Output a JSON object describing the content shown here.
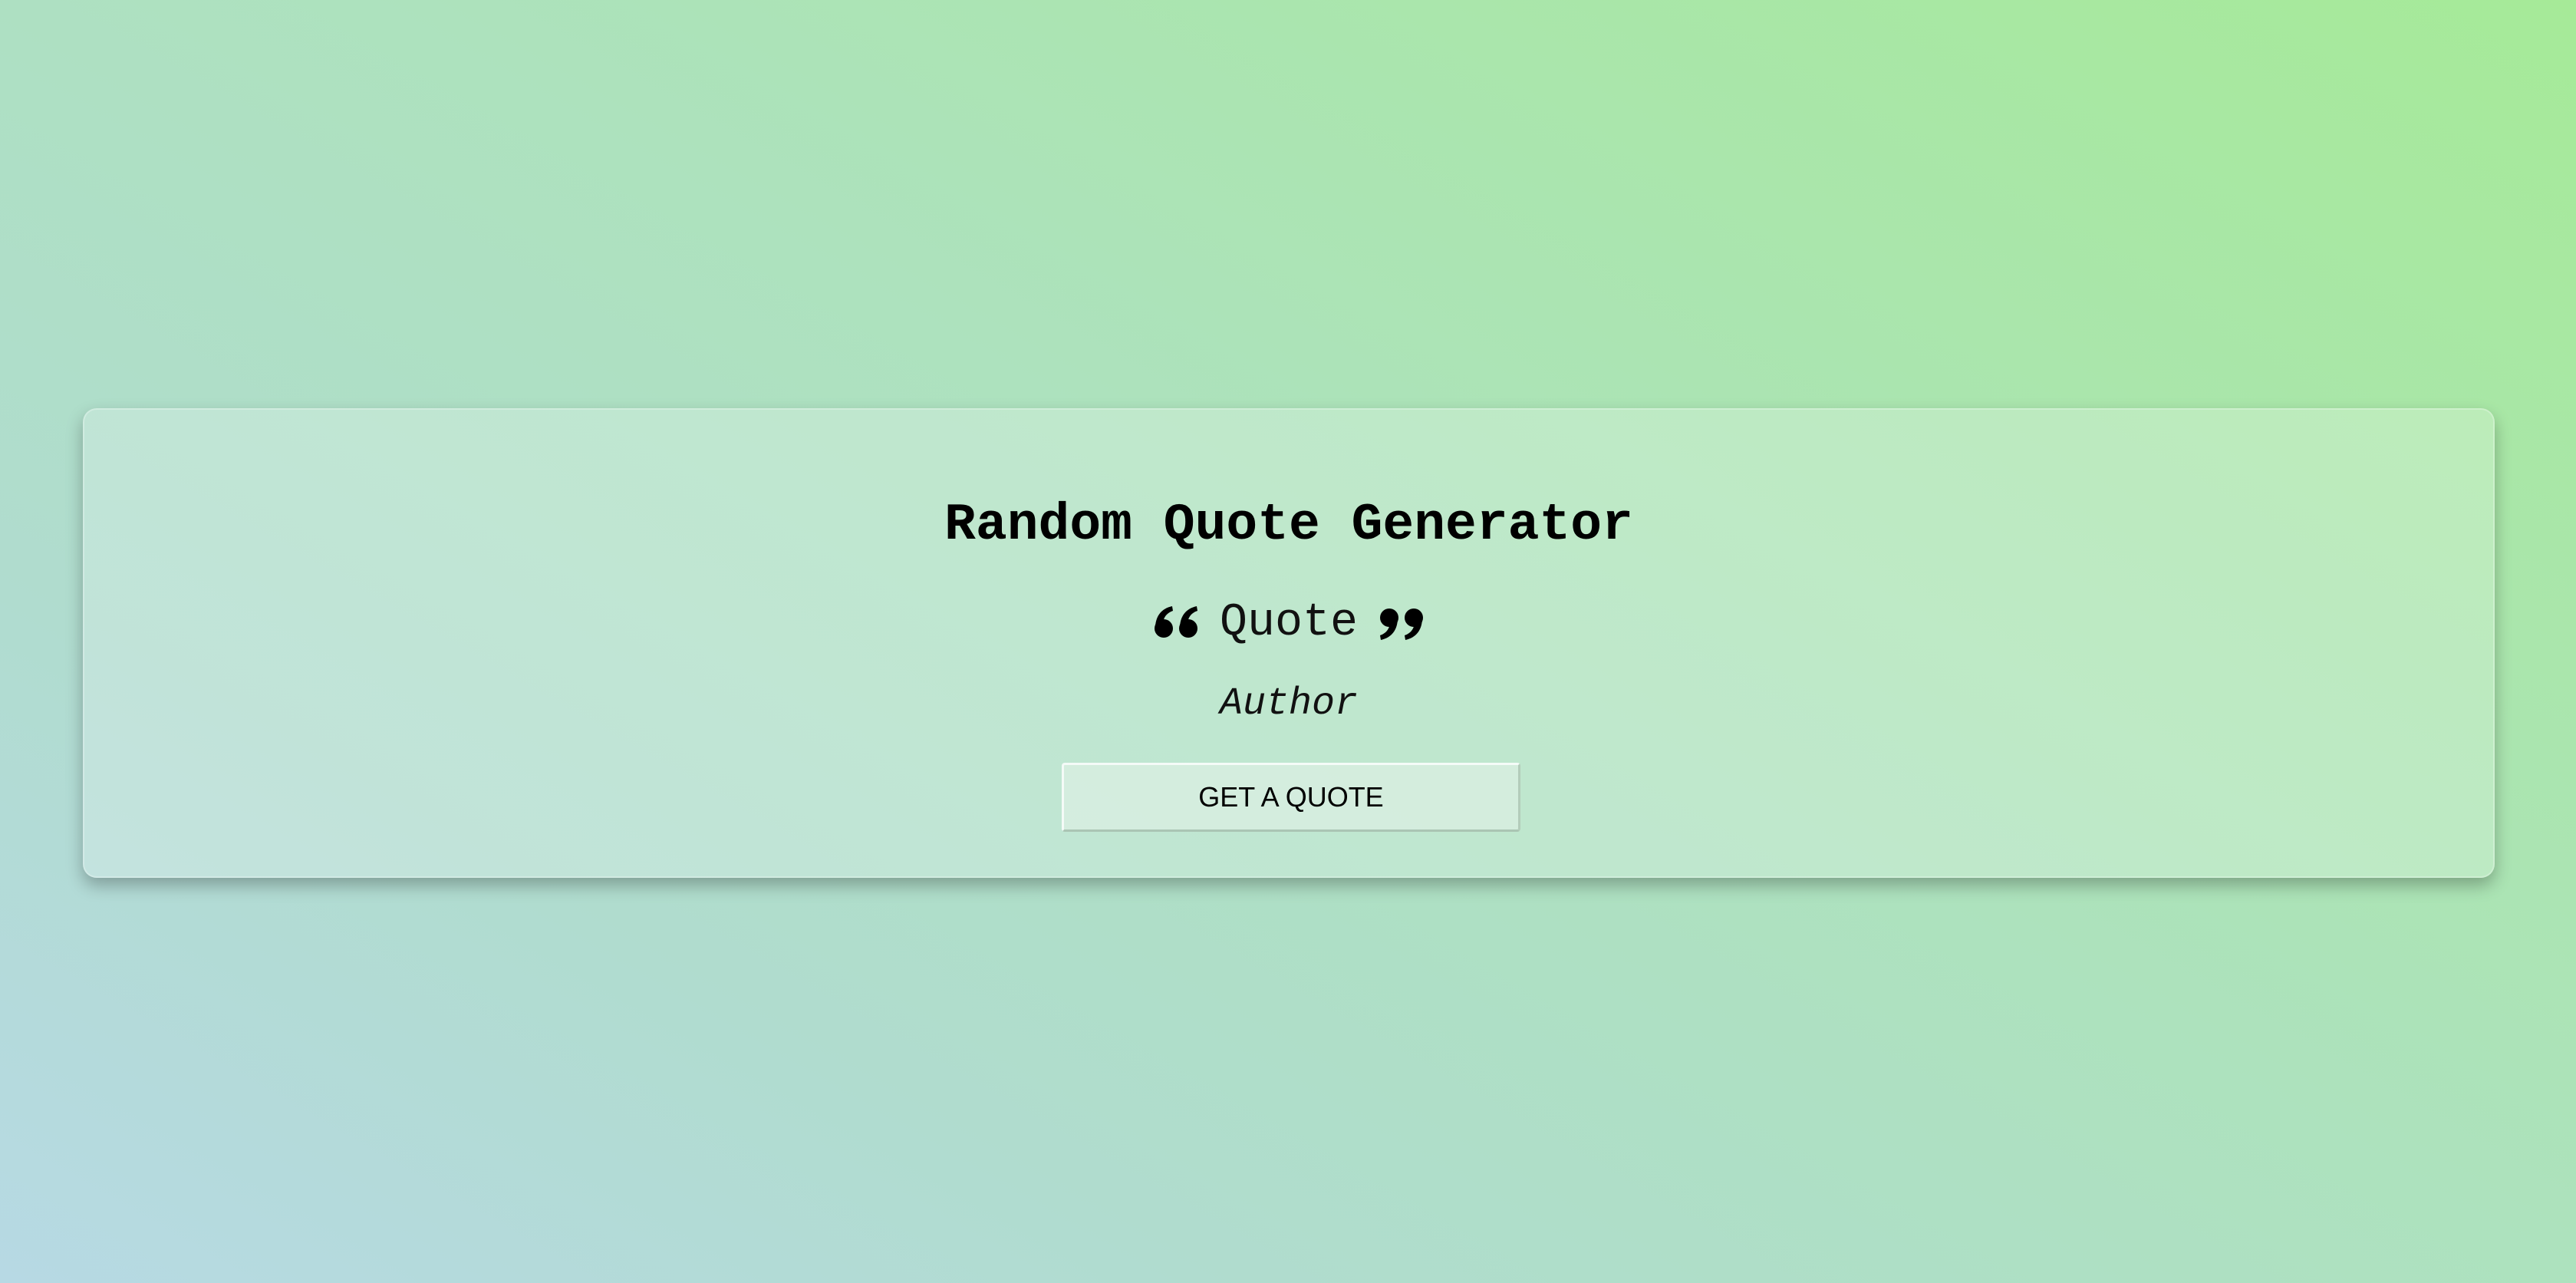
{
  "app": {
    "title": "Random Quote Generator"
  },
  "quote": {
    "text": "Quote",
    "open_icon": "left-double-quote-icon",
    "close_icon": "right-double-quote-icon"
  },
  "author": {
    "text": "Author"
  },
  "actions": {
    "get_quote_label": "GET A QUOTE"
  },
  "colors": {
    "background_start": "#b7d9e4",
    "background_end": "#a6ea98",
    "text": "#000000"
  }
}
